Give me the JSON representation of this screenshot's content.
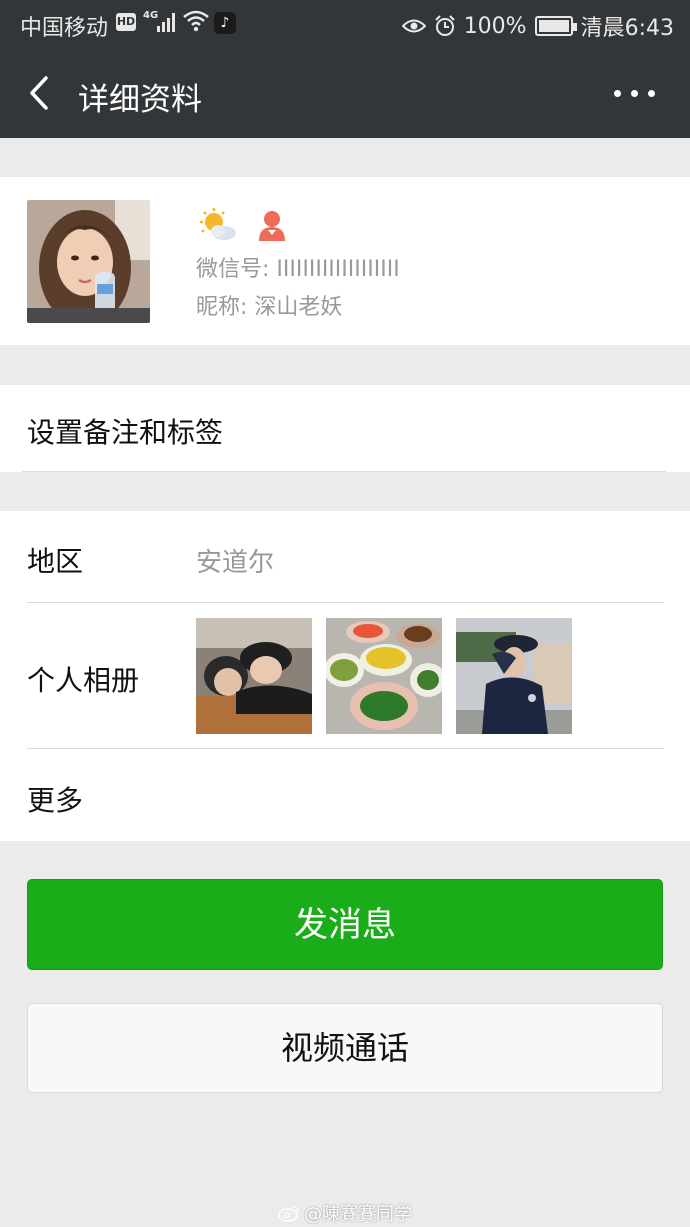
{
  "status_bar": {
    "carrier": "中国移动",
    "hd": "HD",
    "network": "4G",
    "battery": "100%",
    "time": "清晨6:43"
  },
  "header": {
    "title": "详细资料"
  },
  "profile": {
    "wechat_id": "微信号: IIIIIIIIIIIIIIIIIII",
    "nickname": "昵称: 深山老妖"
  },
  "remark": {
    "label": "设置备注和标签"
  },
  "details": {
    "region_label": "地区",
    "region_value": "安道尔",
    "album_label": "个人相册",
    "more_label": "更多"
  },
  "actions": {
    "send_message": "发消息",
    "video_call": "视频通话"
  },
  "watermark": "@陳賽賽同学",
  "colors": {
    "titlebar": "#333638",
    "primary": "#1aad19",
    "background": "#ebebeb"
  }
}
